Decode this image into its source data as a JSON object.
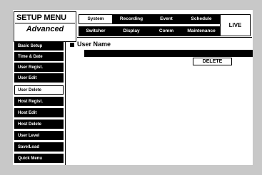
{
  "header": {
    "title": "SETUP MENU",
    "subtitle": "Advanced"
  },
  "tabs_row1": [
    "System",
    "Recording",
    "Event",
    "Schedule"
  ],
  "tabs_row2": [
    "Switcher",
    "Display",
    "Comm",
    "Maintenance"
  ],
  "active_tab": "System",
  "live_label": "LIVE",
  "sidebar": {
    "items": [
      {
        "label": "Basic Setup"
      },
      {
        "label": "Time & Date"
      },
      {
        "label": "User Regist."
      },
      {
        "label": "User Edit"
      },
      {
        "label": "User Delete"
      },
      {
        "label": "Host Regist."
      },
      {
        "label": "Host Edit"
      },
      {
        "label": "Host Delete"
      },
      {
        "label": "User Level"
      },
      {
        "label": "Save/Load"
      },
      {
        "label": "Quick Menu"
      }
    ],
    "active": "User Delete"
  },
  "main": {
    "heading": "User Name",
    "name_value": "",
    "delete_label": "DELETE"
  }
}
